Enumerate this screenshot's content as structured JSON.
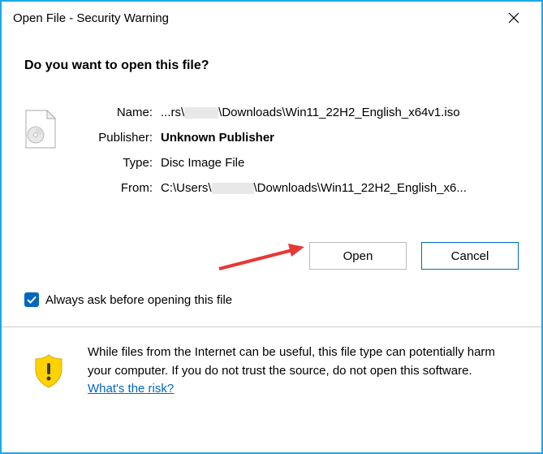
{
  "titlebar": {
    "title": "Open File - Security Warning"
  },
  "heading": "Do you want to open this file?",
  "details": {
    "name_label": "Name:",
    "name_prefix": "...rs\\",
    "name_suffix": "\\Downloads\\Win11_22H2_English_x64v1.iso",
    "publisher_label": "Publisher:",
    "publisher_value": "Unknown Publisher",
    "type_label": "Type:",
    "type_value": "Disc Image File",
    "from_label": "From:",
    "from_prefix": "C:\\Users\\",
    "from_suffix": "\\Downloads\\Win11_22H2_English_x6..."
  },
  "buttons": {
    "open_label": "Open",
    "cancel_label": "Cancel"
  },
  "checkbox": {
    "label": "Always ask before opening this file",
    "checked": true
  },
  "warning": {
    "text_part1": "While files from the Internet can be useful, this file type can potentially harm your computer. If you do not trust the source, do not open this software. ",
    "link_text": "What's the risk?"
  }
}
